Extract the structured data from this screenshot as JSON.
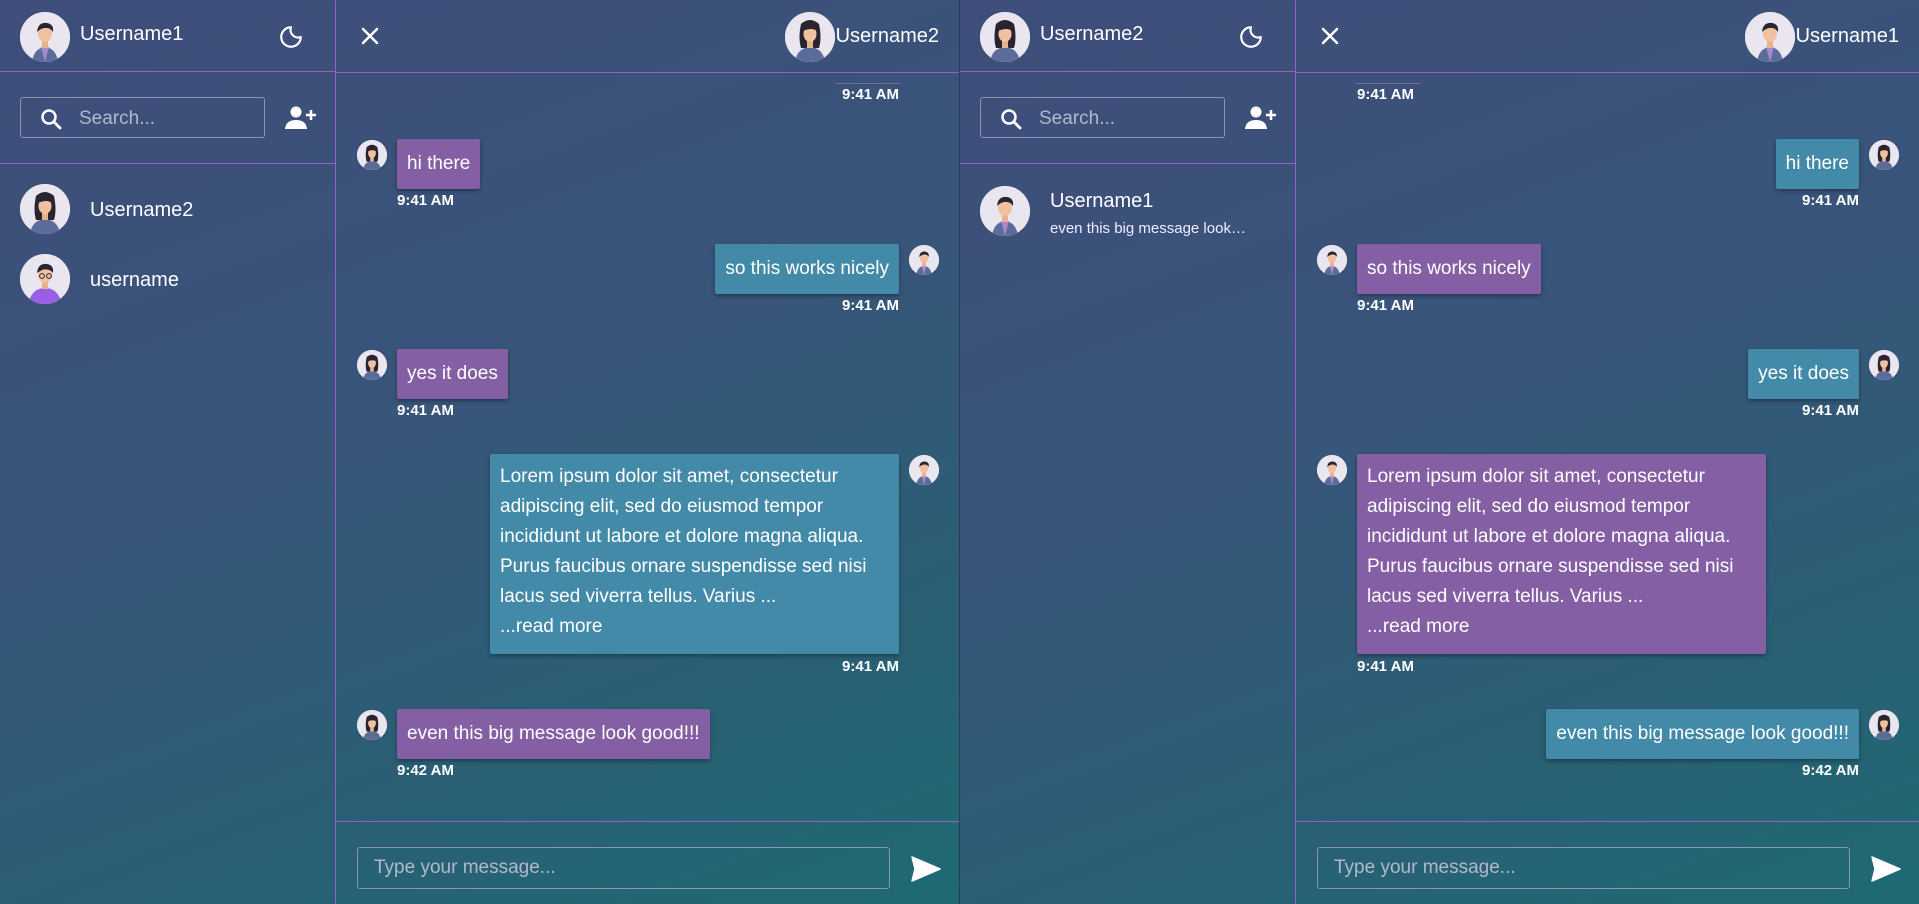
{
  "left": {
    "me": {
      "name": "Username1"
    },
    "search_placeholder": "Search...",
    "contacts": [
      {
        "name": "Username2"
      },
      {
        "name": "username"
      }
    ],
    "peer": {
      "name": "Username2"
    },
    "top_time": "9:41 AM",
    "messages": [
      {
        "text": "hi there",
        "time": "9:41 AM"
      },
      {
        "text": "so this works nicely",
        "time": "9:41 AM"
      },
      {
        "text": "yes it does",
        "time": "9:41 AM"
      },
      {
        "text": "Lorem ipsum dolor sit amet, consectetur adipiscing elit, sed do eiusmod tempor incididunt ut labore et dolore magna aliqua. Purus faucibus ornare suspendisse sed nisi lacus sed viverra tellus. Varius ...",
        "more": "...read more",
        "time": "9:41 AM"
      },
      {
        "text": "even this big message look good!!!",
        "time": "9:42 AM"
      }
    ],
    "composer_placeholder": "Type your message..."
  },
  "right": {
    "me": {
      "name": "Username2"
    },
    "search_placeholder": "Search...",
    "contacts": [
      {
        "name": "Username1",
        "preview": "even this big message look…"
      }
    ],
    "peer": {
      "name": "Username1"
    },
    "top_time": "9:41 AM",
    "messages": [
      {
        "text": "hi there",
        "time": "9:41 AM"
      },
      {
        "text": "so this works nicely",
        "time": "9:41 AM"
      },
      {
        "text": "yes it does",
        "time": "9:41 AM"
      },
      {
        "text": "Lorem ipsum dolor sit amet, consectetur adipiscing elit, sed do eiusmod tempor incididunt ut labore et dolore magna aliqua. Purus faucibus ornare suspendisse sed nisi lacus sed viverra tellus. Varius ...",
        "more": "...read more",
        "time": "9:41 AM"
      },
      {
        "text": "even this big message look good!!!",
        "time": "9:42 AM"
      }
    ],
    "composer_placeholder": "Type your message..."
  },
  "colors": {
    "purple_bubble": "#845fa3",
    "teal_bubble": "#438aa8",
    "accent_line": "#9a5fc4"
  }
}
